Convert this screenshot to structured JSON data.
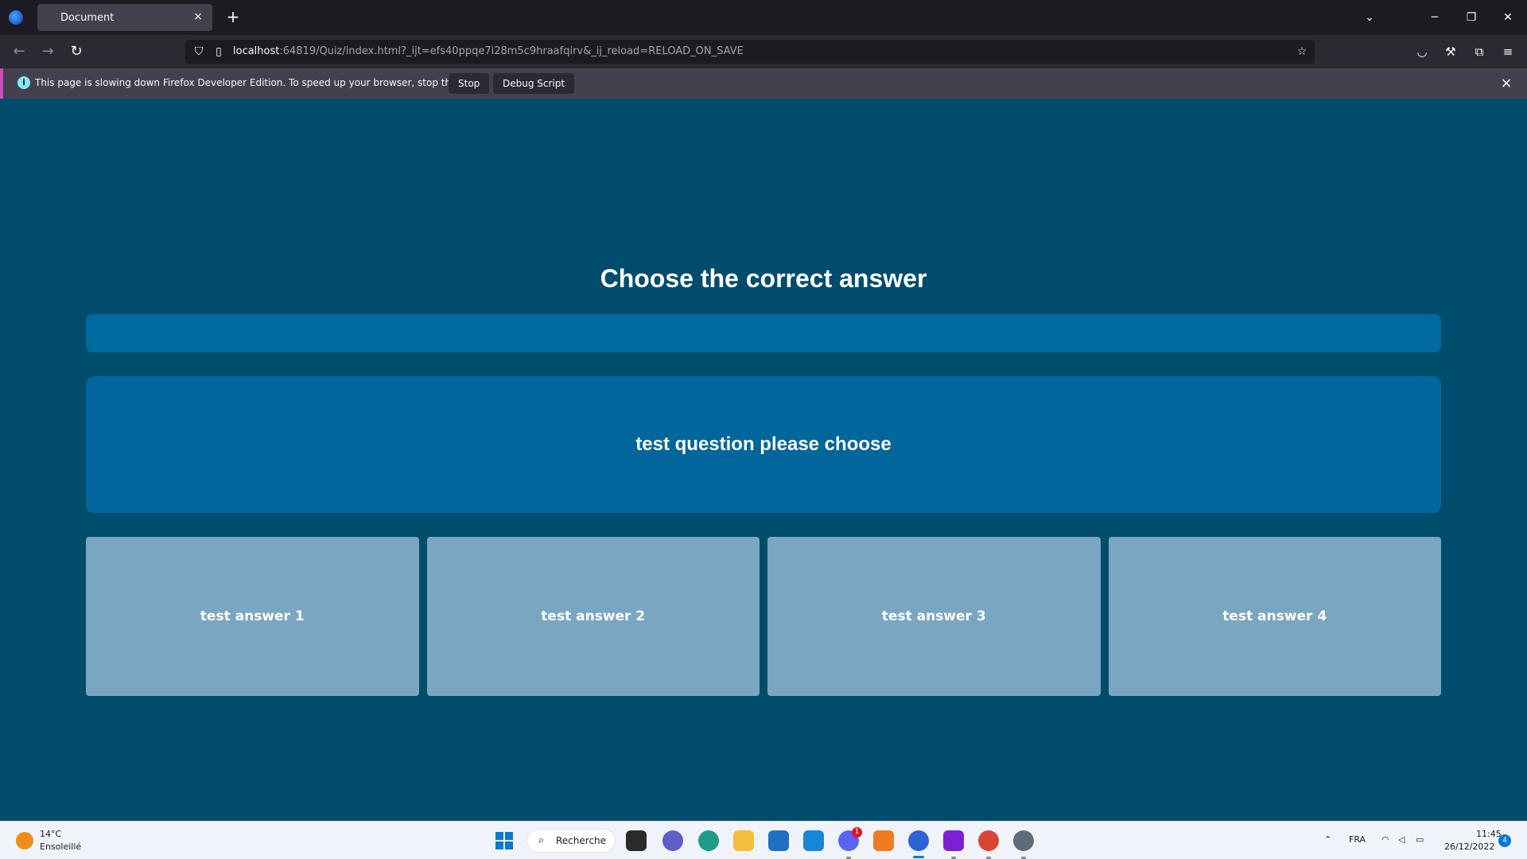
{
  "browser": {
    "tab_title": "Document",
    "tab_close": "×",
    "new_tab": "+",
    "url_host": "localhost",
    "url_rest": ":64819/Quiz/index.html?_ijt=efs40ppqe7i28m5c9hraafqirv&_ij_reload=RELOAD_ON_SAVE",
    "notification": {
      "text": "This page is slowing down Firefox Developer Edition. To speed up your browser, stop this page.",
      "stop_label": "Stop",
      "debug_label": "Debug Script",
      "close": "×",
      "info": "i"
    }
  },
  "quiz": {
    "title": "Choose the correct answer",
    "question": "test question please choose",
    "answers": [
      "test answer 1",
      "test answer 2",
      "test answer 3",
      "test answer 4"
    ]
  },
  "taskbar": {
    "weather_temp": "14°C",
    "weather_desc": "Ensoleillé",
    "search_label": "Recherche",
    "language": "FRA",
    "time": "11:45",
    "date": "26/12/2022",
    "notification_count": "4",
    "discord_badge": "1"
  },
  "colors": {
    "page_bg": "#004c6c",
    "question_bg": "#00669b",
    "answer_bg": "#7ba6c1",
    "accent": "#0a78d4"
  }
}
